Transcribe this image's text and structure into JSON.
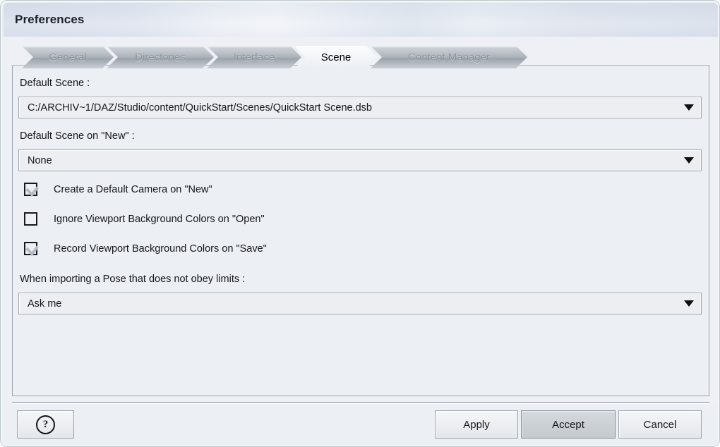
{
  "window": {
    "title": "Preferences"
  },
  "tabs": [
    {
      "label": "General",
      "active": false
    },
    {
      "label": "Directories",
      "active": false
    },
    {
      "label": "Interface",
      "active": false
    },
    {
      "label": "Scene",
      "active": true
    },
    {
      "label": "Content Manager",
      "active": false
    }
  ],
  "scene_panel": {
    "default_scene": {
      "label": "Default Scene :",
      "value": "C:/ARCHIV~1/DAZ/Studio/content/QuickStart/Scenes/QuickStart Scene.dsb",
      "arrow_icon": "chevron-down-icon"
    },
    "default_scene_on_new": {
      "label": "Default Scene on \"New\" :",
      "value": "None",
      "arrow_icon": "chevron-down-icon"
    },
    "checkboxes": [
      {
        "label": "Create a Default Camera on \"New\"",
        "checked": true
      },
      {
        "label": "Ignore Viewport Background Colors on \"Open\"",
        "checked": false
      },
      {
        "label": "Record Viewport Background Colors on \"Save\"",
        "checked": true
      }
    ],
    "pose_limits": {
      "label": "When importing a Pose that does not obey limits :",
      "value": "Ask me",
      "arrow_icon": "chevron-down-icon"
    }
  },
  "footer": {
    "help_icon": "question-mark-circle-icon",
    "apply_label": "Apply",
    "accept_label": "Accept",
    "cancel_label": "Cancel"
  },
  "colors": {
    "window_bg": "#eceff3",
    "panel_bg": "#eceff3",
    "border": "#9aa3ad",
    "tab_inactive_text": "#8d959d",
    "text": "#14161c",
    "check_mark": "#b3bcc8",
    "default_button_bg": "#ccd1d6"
  }
}
